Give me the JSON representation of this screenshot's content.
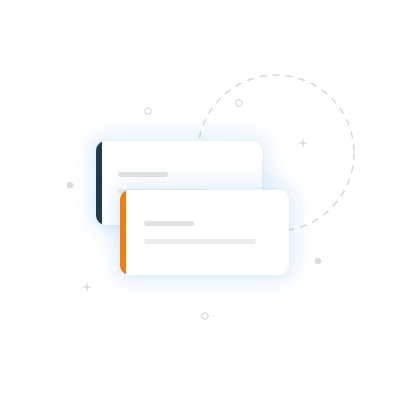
{
  "illustration": {
    "name": "stacked-cards-illustration",
    "colors": {
      "back_card_accent": "#1e3a4c",
      "front_card_accent": "#f07d10",
      "placeholder_line_dark": "#e2e2e2",
      "placeholder_line_light": "#ededed",
      "decoration": "#d6d6d6",
      "glow": "#b8d8f6"
    },
    "cards": [
      {
        "name": "back-card",
        "accent_icon": "dark-accent-bar",
        "text_lines": 2
      },
      {
        "name": "front-card",
        "accent_icon": "orange-accent-bar",
        "text_lines": 2
      }
    ],
    "decorations": [
      "dashed-circle",
      "small-ring",
      "plus-sparkle",
      "dot"
    ]
  }
}
